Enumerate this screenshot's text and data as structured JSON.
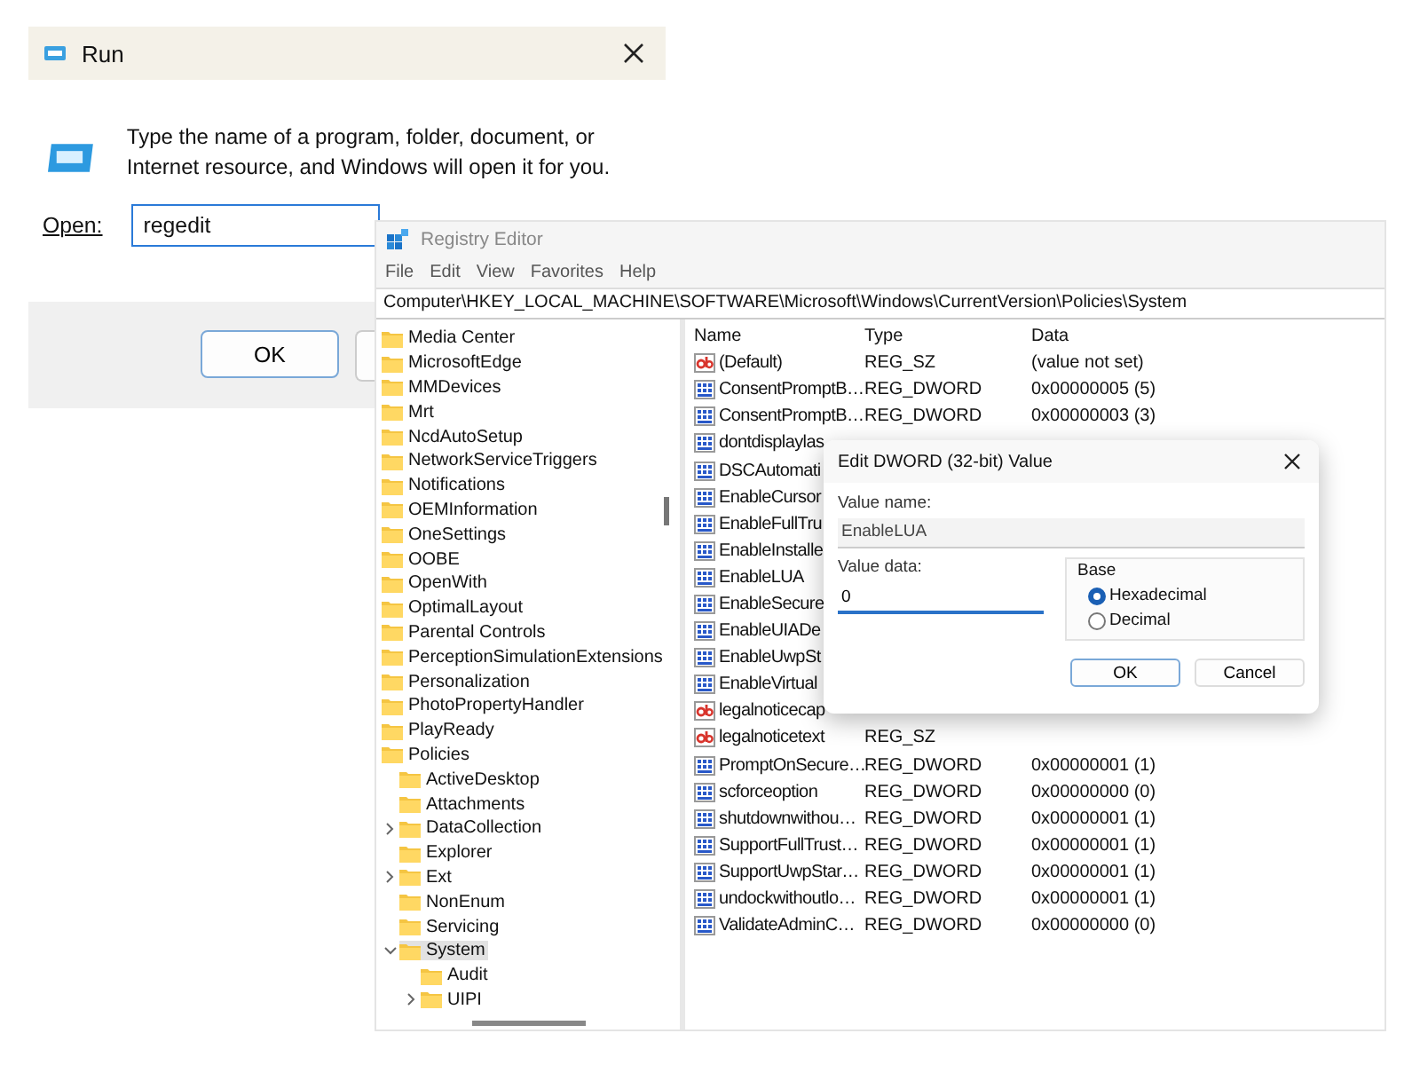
{
  "run_dialog": {
    "title": "Run",
    "message": "Type the name of a program, folder, document, or Internet resource, and Windows will open it for you.",
    "open_label": "Open:",
    "open_value": "regedit",
    "ok_button": "OK"
  },
  "registry_editor": {
    "title": "Registry Editor",
    "menu": [
      "File",
      "Edit",
      "View",
      "Favorites",
      "Help"
    ],
    "address": "Computer\\HKEY_LOCAL_MACHINE\\SOFTWARE\\Microsoft\\Windows\\CurrentVersion\\Policies\\System",
    "tree": [
      {
        "label": "Media Center",
        "selected": false
      },
      {
        "label": "MicrosoftEdge",
        "selected": false
      },
      {
        "label": "MMDevices",
        "selected": false
      },
      {
        "label": "Mrt",
        "selected": false
      },
      {
        "label": "NcdAutoSetup",
        "selected": false
      },
      {
        "label": "NetworkServiceTriggers",
        "selected": false
      },
      {
        "label": "Notifications",
        "selected": false
      },
      {
        "label": "OEMInformation",
        "selected": false
      },
      {
        "label": "OneSettings",
        "selected": false
      },
      {
        "label": "OOBE",
        "selected": false
      },
      {
        "label": "OpenWith",
        "selected": false
      },
      {
        "label": "OptimalLayout",
        "selected": false
      },
      {
        "label": "Parental Controls",
        "selected": false
      },
      {
        "label": "PerceptionSimulationExtensions",
        "selected": false
      },
      {
        "label": "Personalization",
        "selected": false
      },
      {
        "label": "PhotoPropertyHandler",
        "selected": false
      },
      {
        "label": "PlayReady",
        "selected": false
      },
      {
        "label": "Policies",
        "selected": false,
        "children": [
          {
            "label": "ActiveDesktop",
            "selected": false
          },
          {
            "label": "Attachments",
            "selected": false
          },
          {
            "label": "DataCollection",
            "selected": false,
            "collapsed": true
          },
          {
            "label": "Explorer",
            "selected": false
          },
          {
            "label": "Ext",
            "selected": false,
            "collapsed": true
          },
          {
            "label": "NonEnum",
            "selected": false
          },
          {
            "label": "Servicing",
            "selected": false
          },
          {
            "label": "System",
            "selected": true,
            "expanded": true,
            "children": [
              {
                "label": "Audit",
                "selected": false
              },
              {
                "label": "UIPI",
                "selected": false,
                "collapsed": true
              }
            ]
          }
        ]
      }
    ],
    "columns": [
      "Name",
      "Type",
      "Data"
    ],
    "values": [
      {
        "kind": "string",
        "name": "(Default)",
        "type": "REG_SZ",
        "data": "(value not set)"
      },
      {
        "kind": "dword",
        "name": "ConsentPromptB…",
        "type": "REG_DWORD",
        "data": "0x00000005 (5)"
      },
      {
        "kind": "dword",
        "name": "ConsentPromptB…",
        "type": "REG_DWORD",
        "data": "0x00000003 (3)"
      },
      {
        "kind": "dword",
        "name": "dontdisplaylas"
      },
      {
        "kind": "dword",
        "name": "DSCAutomati"
      },
      {
        "kind": "dword",
        "name": "EnableCursor"
      },
      {
        "kind": "dword",
        "name": "EnableFullTru"
      },
      {
        "kind": "dword",
        "name": "EnableInstalle"
      },
      {
        "kind": "dword",
        "name": "EnableLUA"
      },
      {
        "kind": "dword",
        "name": "EnableSecure"
      },
      {
        "kind": "dword",
        "name": "EnableUIADe"
      },
      {
        "kind": "dword",
        "name": "EnableUwpSt"
      },
      {
        "kind": "dword",
        "name": "EnableVirtual"
      },
      {
        "kind": "string",
        "name": "legalnoticecap"
      },
      {
        "kind": "string",
        "name": "legalnoticetext",
        "type": "REG_SZ"
      },
      {
        "kind": "dword",
        "name": "PromptOnSecure…",
        "type": "REG_DWORD",
        "data": "0x00000001 (1)"
      },
      {
        "kind": "dword",
        "name": "scforceoption",
        "type": "REG_DWORD",
        "data": "0x00000000 (0)"
      },
      {
        "kind": "dword",
        "name": "shutdownwithou…",
        "type": "REG_DWORD",
        "data": "0x00000001 (1)"
      },
      {
        "kind": "dword",
        "name": "SupportFullTrust…",
        "type": "REG_DWORD",
        "data": "0x00000001 (1)"
      },
      {
        "kind": "dword",
        "name": "SupportUwpStar…",
        "type": "REG_DWORD",
        "data": "0x00000001 (1)"
      },
      {
        "kind": "dword",
        "name": "undockwithoutlo…",
        "type": "REG_DWORD",
        "data": "0x00000001 (1)"
      },
      {
        "kind": "dword",
        "name": "ValidateAdminC…",
        "type": "REG_DWORD",
        "data": "0x00000000 (0)"
      }
    ]
  },
  "edit_dialog": {
    "title": "Edit DWORD (32-bit) Value",
    "value_name_label": "Value name:",
    "value_name": "EnableLUA",
    "value_data_label": "Value data:",
    "value_data": "0",
    "base_label": "Base",
    "base_options": [
      {
        "label": "Hexadecimal",
        "selected": true
      },
      {
        "label": "Decimal",
        "selected": false
      }
    ],
    "ok_button": "OK",
    "cancel_button": "Cancel"
  }
}
